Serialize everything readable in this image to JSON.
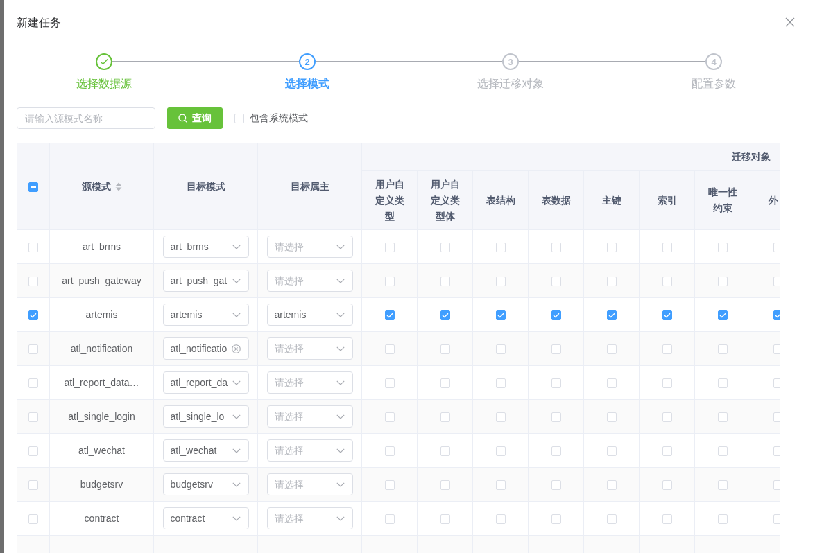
{
  "dialog": {
    "title": "新建任务"
  },
  "steps": [
    {
      "label": "选择数据源",
      "completed": true,
      "selected": false
    },
    {
      "number": "2",
      "label": "选择模式",
      "completed": false,
      "selected": true
    },
    {
      "number": "3",
      "label": "选择迁移对象",
      "completed": false,
      "selected": false
    },
    {
      "number": "4",
      "label": "配置参数",
      "completed": false,
      "selected": false
    }
  ],
  "toolbar": {
    "search": {
      "placeholder": "请输入源模式名称"
    },
    "query_button": "查询",
    "include_system": {
      "label": "包含系统模式",
      "checked": false
    }
  },
  "table": {
    "select_all": {
      "indeterminate": true
    },
    "columns": [
      {
        "label": "源模式",
        "sortable": true
      },
      {
        "label": "目标模式",
        "sortable": false
      },
      {
        "label": "目标属主",
        "sortable": false
      }
    ],
    "group_header": "迁移对象",
    "object_columns": [
      "用户自定义类型",
      "用户自定义类型体",
      "表结构",
      "表数据",
      "主键",
      "索引",
      "唯一性约束",
      "外"
    ],
    "rows": [
      {
        "checked": false,
        "source": "art_brms",
        "target": {
          "value": "art_brms",
          "clear_icon": false
        },
        "owner": {
          "placeholder": "请选择"
        },
        "objects": [
          {
            "checked": false
          },
          {
            "checked": false
          },
          {
            "checked": false
          },
          {
            "checked": false
          },
          {
            "checked": false
          },
          {
            "checked": false
          },
          {
            "checked": false
          },
          {
            "checked": false
          }
        ]
      },
      {
        "checked": false,
        "source": "art_push_gateway",
        "target": {
          "value": "art_push_gat",
          "clear_icon": false
        },
        "owner": {
          "placeholder": "请选择"
        },
        "objects": [
          {
            "checked": false
          },
          {
            "checked": false
          },
          {
            "checked": false
          },
          {
            "checked": false
          },
          {
            "checked": false
          },
          {
            "checked": false
          },
          {
            "checked": false
          },
          {
            "checked": false
          }
        ]
      },
      {
        "checked": true,
        "source": "artemis",
        "target": {
          "value": "artemis",
          "clear_icon": false
        },
        "owner": {
          "value": "artemis"
        },
        "objects": [
          {
            "checked": true
          },
          {
            "checked": true
          },
          {
            "checked": true
          },
          {
            "checked": true
          },
          {
            "checked": true
          },
          {
            "checked": true
          },
          {
            "checked": true
          },
          {
            "checked": true
          }
        ]
      },
      {
        "checked": false,
        "source": "atl_notification",
        "target": {
          "value": "atl_notificatio",
          "clear_icon": true
        },
        "owner": {
          "placeholder": "请选择"
        },
        "objects": [
          {
            "checked": false
          },
          {
            "checked": false
          },
          {
            "checked": false
          },
          {
            "checked": false
          },
          {
            "checked": false
          },
          {
            "checked": false
          },
          {
            "checked": false
          },
          {
            "checked": false
          }
        ]
      },
      {
        "checked": false,
        "source": "atl_report_data…",
        "target": {
          "value": "atl_report_da",
          "clear_icon": false
        },
        "owner": {
          "placeholder": "请选择"
        },
        "objects": [
          {
            "checked": false
          },
          {
            "checked": false
          },
          {
            "checked": false
          },
          {
            "checked": false
          },
          {
            "checked": false
          },
          {
            "checked": false
          },
          {
            "checked": false
          },
          {
            "checked": false
          }
        ]
      },
      {
        "checked": false,
        "source": "atl_single_login",
        "target": {
          "value": "atl_single_lo",
          "clear_icon": false
        },
        "owner": {
          "placeholder": "请选择"
        },
        "objects": [
          {
            "checked": false
          },
          {
            "checked": false
          },
          {
            "checked": false
          },
          {
            "checked": false
          },
          {
            "checked": false
          },
          {
            "checked": false
          },
          {
            "checked": false
          },
          {
            "checked": false
          }
        ]
      },
      {
        "checked": false,
        "source": "atl_wechat",
        "target": {
          "value": "atl_wechat",
          "clear_icon": false
        },
        "owner": {
          "placeholder": "请选择"
        },
        "objects": [
          {
            "checked": false
          },
          {
            "checked": false
          },
          {
            "checked": false
          },
          {
            "checked": false
          },
          {
            "checked": false
          },
          {
            "checked": false
          },
          {
            "checked": false
          },
          {
            "checked": false
          }
        ]
      },
      {
        "checked": false,
        "source": "budgetsrv",
        "target": {
          "value": "budgetsrv",
          "clear_icon": false
        },
        "owner": {
          "placeholder": "请选择"
        },
        "objects": [
          {
            "checked": false
          },
          {
            "checked": false
          },
          {
            "checked": false
          },
          {
            "checked": false
          },
          {
            "checked": false
          },
          {
            "checked": false
          },
          {
            "checked": false
          },
          {
            "checked": false
          }
        ]
      },
      {
        "checked": false,
        "source": "contract",
        "target": {
          "value": "contract",
          "clear_icon": false
        },
        "owner": {
          "placeholder": "请选择"
        },
        "objects": [
          {
            "checked": false
          },
          {
            "checked": false
          },
          {
            "checked": false
          },
          {
            "checked": false
          },
          {
            "checked": false
          },
          {
            "checked": false
          },
          {
            "checked": false
          },
          {
            "checked": false
          }
        ]
      }
    ]
  }
}
